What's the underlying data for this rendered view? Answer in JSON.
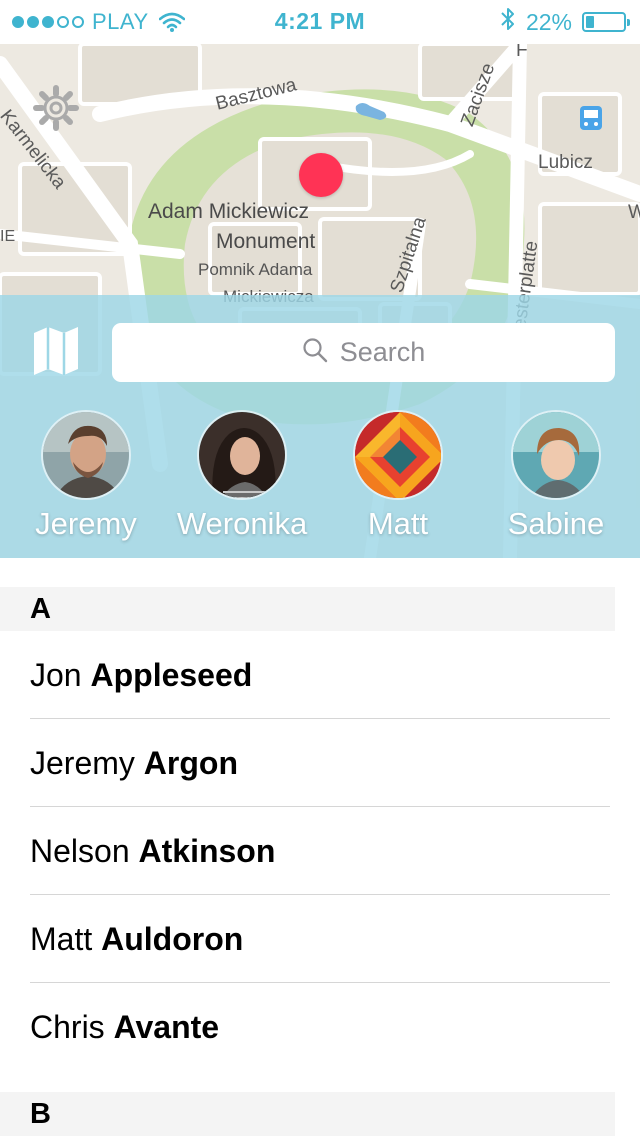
{
  "status_bar": {
    "carrier": "PLAY",
    "time": "4:21 PM",
    "battery": "22%",
    "battery_level": 0.22,
    "signal_bars": 3,
    "signal_total": 5,
    "color": "#3fb4cf"
  },
  "map": {
    "labels": {
      "street_basztowa": "Basztowa",
      "street_karmelicka": "Karmelicka",
      "street_zacisze": "Zacisze",
      "street_lubicz": "Lubicz",
      "street_szpitalna": "Szpitalna",
      "street_westerplatte": "esterplatte",
      "poi_line1": "Adam Mickiewicz",
      "poi_line2": "Monument",
      "poi_line3": "Pomnik Adama",
      "poi_line4": "Mickiewicza",
      "edge_ie": "IE",
      "edge_f": "F",
      "edge_w": "W"
    },
    "pin_color": "#ff3355",
    "park_color": "#c9dfa8"
  },
  "search": {
    "placeholder": "Search"
  },
  "favorites": [
    {
      "name": "Jeremy",
      "avatar": "photo-man"
    },
    {
      "name": "Weronika",
      "avatar": "photo-woman"
    },
    {
      "name": "Matt",
      "avatar": "geometric-pattern"
    },
    {
      "name": "Sabine",
      "avatar": "photo-child"
    }
  ],
  "contacts": {
    "sections": [
      {
        "letter": "A",
        "rows": [
          {
            "first": "Jon",
            "last": "Appleseed"
          },
          {
            "first": "Jeremy",
            "last": "Argon"
          },
          {
            "first": "Nelson",
            "last": "Atkinson"
          },
          {
            "first": "Matt",
            "last": "Auldoron"
          },
          {
            "first": "Chris",
            "last": "Avante"
          }
        ]
      },
      {
        "letter": "B",
        "rows": []
      }
    ]
  },
  "colors": {
    "accent": "#3fb4cf",
    "overlay": "#9ed7e6"
  }
}
